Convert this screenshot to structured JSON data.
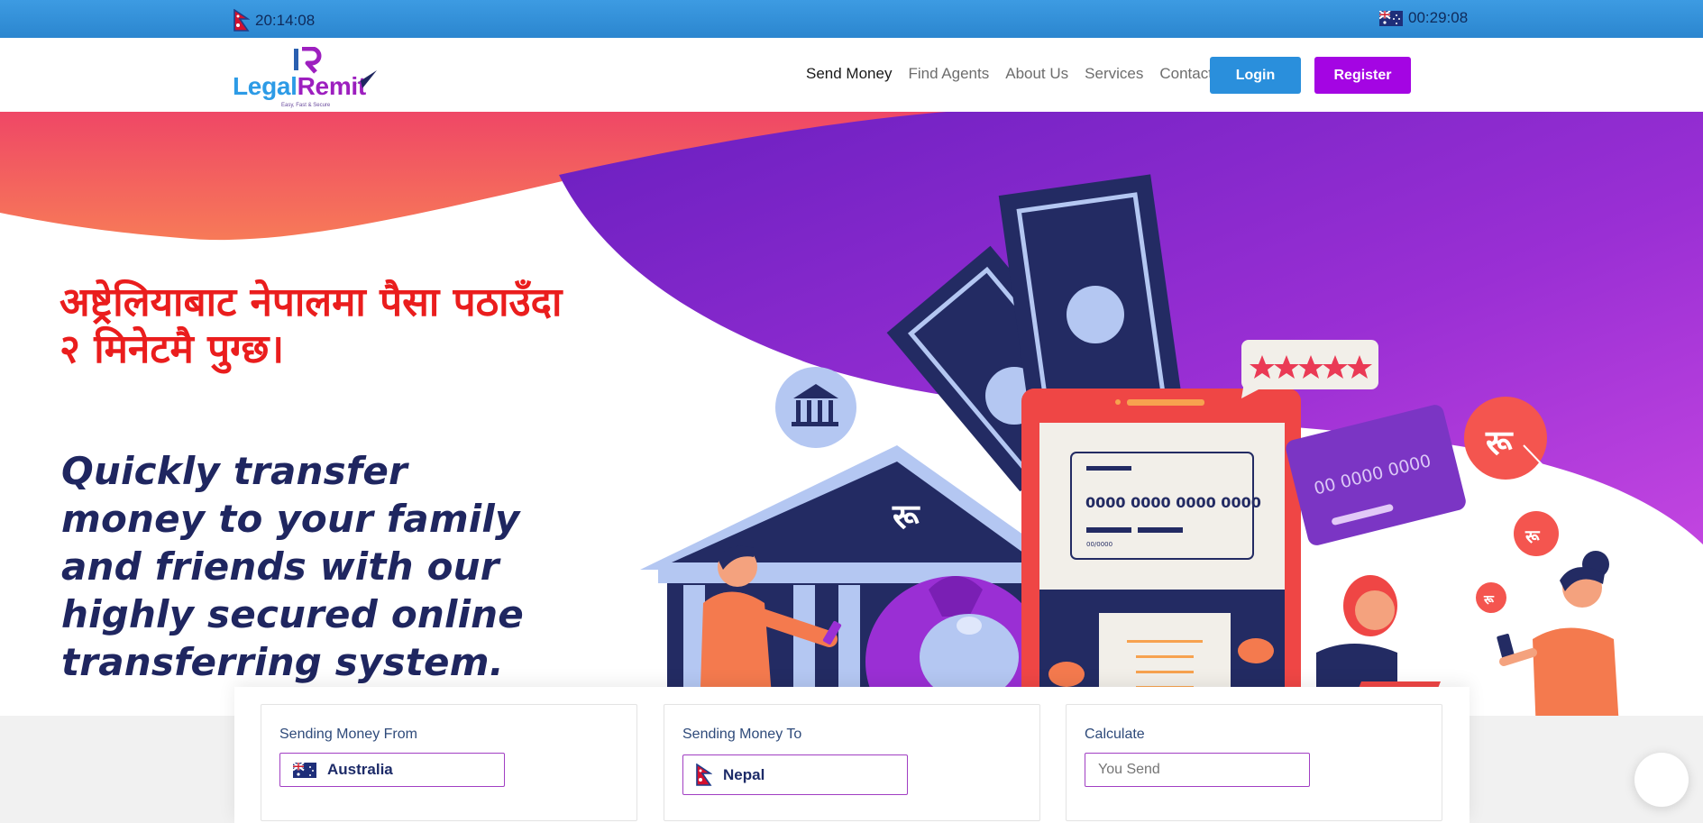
{
  "top_bar": {
    "nepal_time": "20:14:08",
    "australia_time": "00:29:08"
  },
  "logo": {
    "part1": "Legal",
    "part2": "Remit",
    "tagline": "Easy, Fast & Secure"
  },
  "nav": {
    "items": [
      {
        "label": "Send Money",
        "active": true
      },
      {
        "label": "Find Agents",
        "active": false
      },
      {
        "label": "About Us",
        "active": false
      },
      {
        "label": "Services",
        "active": false
      },
      {
        "label": "Contact",
        "active": false
      }
    ],
    "login_label": "Login",
    "register_label": "Register"
  },
  "hero": {
    "nepali_headline": "अष्ट्रेलियाबाट नेपालमा पैसा पठाउँदा २ मिनेटमै पुग्छ।",
    "english_headline": "Quickly transfer money to your family and friends with our highly secured online transferring system.",
    "illustration": {
      "card_number_phone": "0000 0000 0000 0000",
      "card_expiry": "00/0000",
      "card_number_credit": "00 0000 0000",
      "currency_symbol": "रू"
    }
  },
  "calculator": {
    "from": {
      "label": "Sending Money From",
      "country": "Australia"
    },
    "to": {
      "label": "Sending Money To",
      "country": "Nepal"
    },
    "calc": {
      "label": "Calculate",
      "placeholder": "You Send"
    }
  },
  "colors": {
    "topbar": "#2f8fd8",
    "login": "#2a8fdc",
    "register": "#a405e3",
    "headline_red": "#ea1d1d",
    "headline_navy": "#1f2660"
  },
  "icons": [
    "nepal-flag-icon",
    "australia-flag-icon",
    "bank-icon",
    "star-icon",
    "rupee-icon",
    "checkmark-icon",
    "chevron-right-icon",
    "chat-icon"
  ]
}
